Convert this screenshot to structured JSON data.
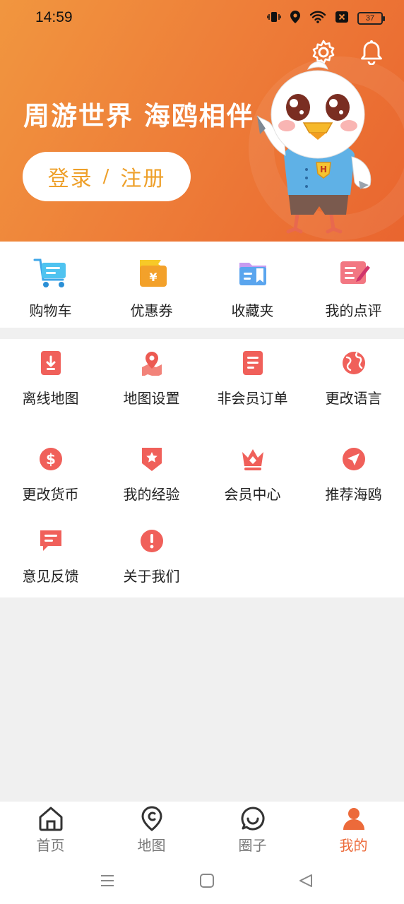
{
  "status": {
    "time": "14:59",
    "battery": "37"
  },
  "header": {
    "slogan": "周游世界 海鸥相伴",
    "login_label": "登录",
    "separator": "/",
    "register_label": "注册",
    "mascot_badge": "H"
  },
  "quick": [
    {
      "label": "购物车",
      "icon": "shopping-cart-icon"
    },
    {
      "label": "优惠券",
      "icon": "coupon-icon"
    },
    {
      "label": "收藏夹",
      "icon": "favorites-folder-icon"
    },
    {
      "label": "我的点评",
      "icon": "review-icon"
    }
  ],
  "grid": [
    {
      "label": "离线地图",
      "icon": "offline-map-icon"
    },
    {
      "label": "地图设置",
      "icon": "map-settings-icon"
    },
    {
      "label": "非会员订单",
      "icon": "non-member-order-icon"
    },
    {
      "label": "更改语言",
      "icon": "globe-icon"
    },
    {
      "label": "更改货币",
      "icon": "currency-icon"
    },
    {
      "label": "我的经验",
      "icon": "experience-badge-icon"
    },
    {
      "label": "会员中心",
      "icon": "crown-icon"
    },
    {
      "label": "推荐海鸥",
      "icon": "share-arrow-icon"
    },
    {
      "label": "意见反馈",
      "icon": "feedback-icon"
    },
    {
      "label": "关于我们",
      "icon": "info-icon"
    }
  ],
  "bottom_nav": [
    {
      "label": "首页",
      "icon": "home-icon"
    },
    {
      "label": "地图",
      "icon": "map-icon"
    },
    {
      "label": "圈子",
      "icon": "chat-circle-icon"
    },
    {
      "label": "我的",
      "icon": "user-icon",
      "active": true
    }
  ],
  "colors": {
    "accent": "#ec6a3a",
    "login_text": "#eea02a",
    "header_start": "#f1963f",
    "header_end": "#e9652f"
  }
}
